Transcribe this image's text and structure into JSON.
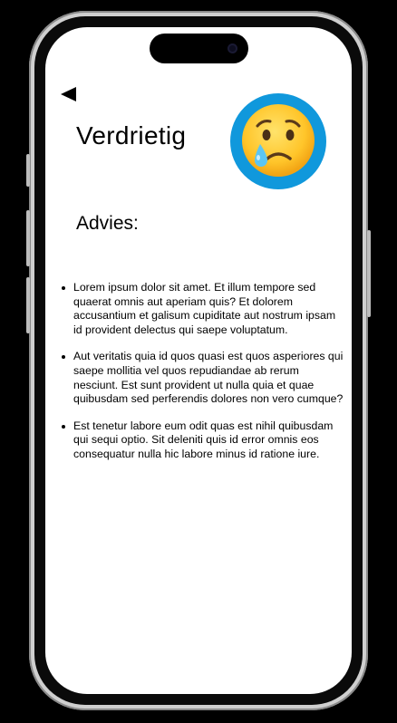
{
  "screen": {
    "title": "Verdrietig",
    "emoji": "crying-face-icon",
    "section_heading": "Advies:",
    "back_icon": "back-arrow-icon",
    "tips": [
      "Lorem ipsum dolor sit amet. Et illum tempore sed quaerat omnis aut aperiam quis? Et dolorem accusantium et galisum cupiditate aut nostrum ipsam id provident delectus qui saepe voluptatum.",
      "Aut veritatis quia id quos quasi est quos asperiores qui saepe mollitia vel quos repudiandae ab rerum nesciunt. Est sunt provident ut nulla quia et quae quibusdam sed perferendis dolores non vero cumque?",
      "Est tenetur labore eum odit quas est nihil quibusdam qui sequi optio. Sit deleniti quis id error omnis eos consequatur nulla hic labore minus id ratione iure."
    ]
  },
  "colors": {
    "emoji_background": "#1098dc",
    "emoji_face": "#ffcb2e",
    "tear": "#5cc5f2"
  }
}
